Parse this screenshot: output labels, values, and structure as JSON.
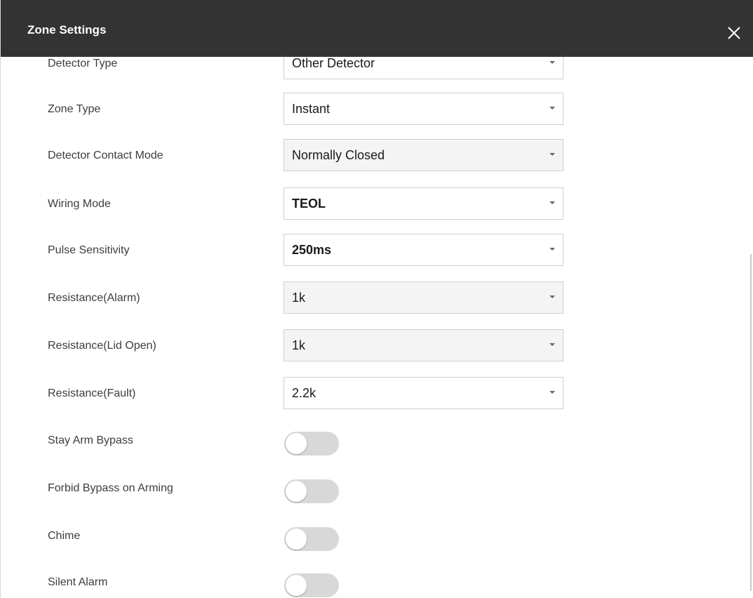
{
  "dialog": {
    "title": "Zone Settings",
    "close_icon": "close-icon"
  },
  "fields": [
    {
      "key": "detector_type",
      "label": "Detector Type",
      "value": "Other Detector",
      "type": "select",
      "disabled": false,
      "bold": false
    },
    {
      "key": "zone_type",
      "label": "Zone Type",
      "value": "Instant",
      "type": "select",
      "disabled": false,
      "bold": false
    },
    {
      "key": "detector_contact_mode",
      "label": "Detector Contact Mode",
      "value": "Normally Closed",
      "type": "select",
      "disabled": true,
      "bold": false
    },
    {
      "key": "wiring_mode",
      "label": "Wiring Mode",
      "value": "TEOL",
      "type": "select",
      "disabled": false,
      "bold": true
    },
    {
      "key": "pulse_sensitivity",
      "label": "Pulse Sensitivity",
      "value": "250ms",
      "type": "select",
      "disabled": false,
      "bold": true
    },
    {
      "key": "resistance_alarm",
      "label": "Resistance(Alarm)",
      "value": "1k",
      "type": "select",
      "disabled": true,
      "bold": false
    },
    {
      "key": "resistance_lid_open",
      "label": "Resistance(Lid Open)",
      "value": "1k",
      "type": "select",
      "disabled": true,
      "bold": false
    },
    {
      "key": "resistance_fault",
      "label": "Resistance(Fault)",
      "value": "2.2k",
      "type": "select",
      "disabled": false,
      "bold": false
    }
  ],
  "toggles": [
    {
      "key": "stay_arm_bypass",
      "label": "Stay Arm Bypass",
      "on": false
    },
    {
      "key": "forbid_bypass_on_arming",
      "label": "Forbid Bypass on Arming",
      "on": false
    },
    {
      "key": "chime",
      "label": "Chime",
      "on": false
    },
    {
      "key": "silent_alarm",
      "label": "Silent Alarm",
      "on": false
    }
  ],
  "colors": {
    "header_bg": "#333333",
    "toggle_off": "#d8d8d8",
    "label_text": "#3d3d3d"
  }
}
